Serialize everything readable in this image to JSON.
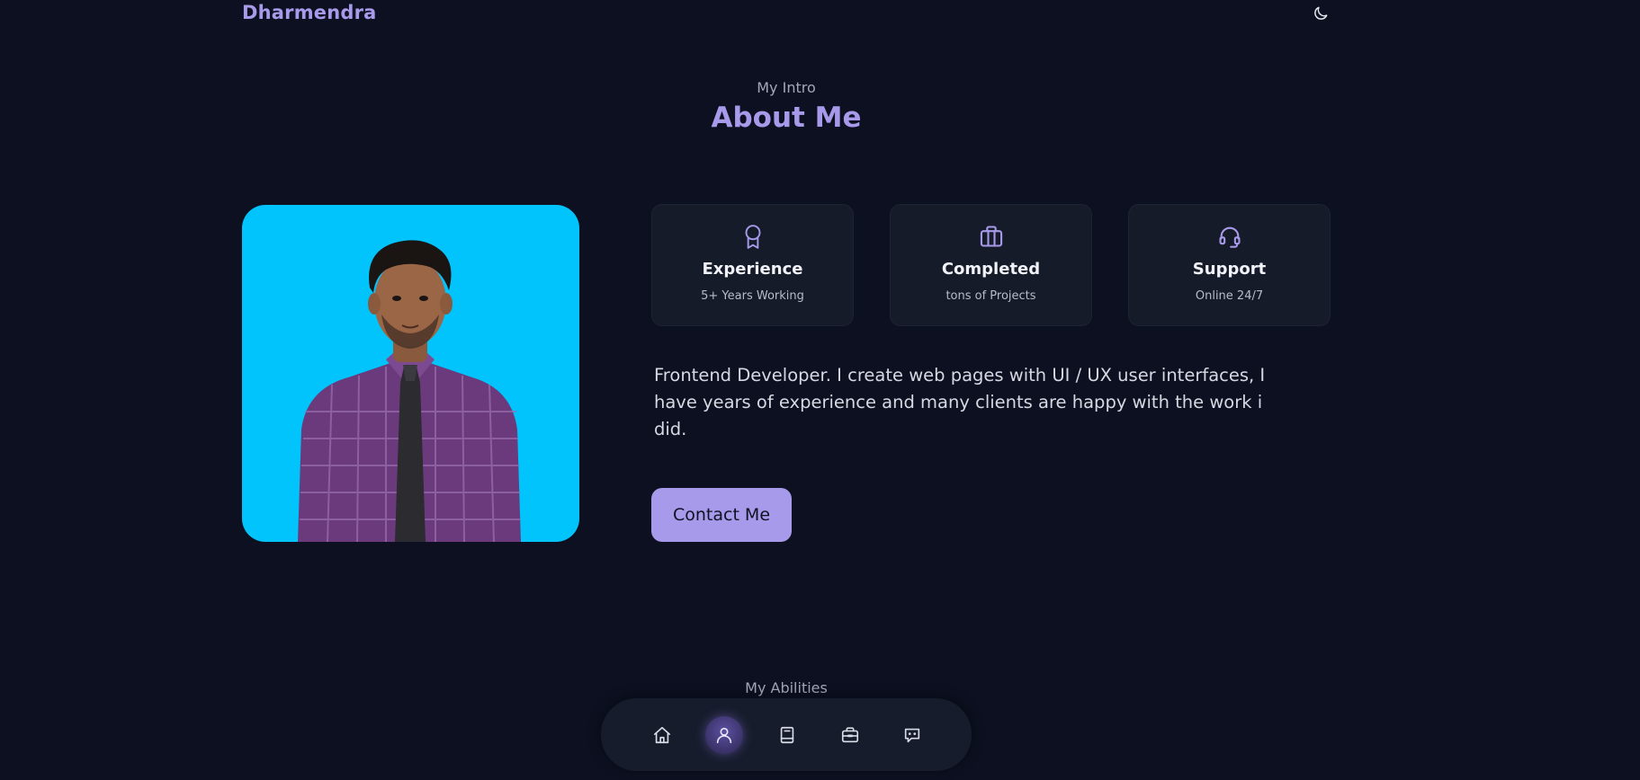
{
  "header": {
    "brand": "Dharmendra",
    "theme_icon": "moon-icon"
  },
  "about": {
    "subtitle": "My Intro",
    "title": "About Me",
    "photo_alt": "Portrait photo",
    "cards": [
      {
        "icon": "award-icon",
        "title": "Experience",
        "subtitle": "5+ Years Working"
      },
      {
        "icon": "briefcase-icon",
        "title": "Completed",
        "subtitle": "tons of Projects"
      },
      {
        "icon": "headset-icon",
        "title": "Support",
        "subtitle": "Online 24/7"
      }
    ],
    "description": "Frontend Developer. I create web pages with UI / UX user interfaces, I have years of experience and many clients are happy with the work i did.",
    "contact_label": "Contact Me"
  },
  "abilities": {
    "subtitle": "My Abilities"
  },
  "bottom_nav": {
    "items": [
      {
        "icon": "home-icon",
        "active": false
      },
      {
        "icon": "user-icon",
        "active": true
      },
      {
        "icon": "book-icon",
        "active": false
      },
      {
        "icon": "briefcase-icon",
        "active": false
      },
      {
        "icon": "chat-icon",
        "active": false
      }
    ]
  },
  "colors": {
    "background": "#0c1020",
    "accent": "#a89aea",
    "card": "#161b2a",
    "photo_bg": "#00c4fb"
  }
}
